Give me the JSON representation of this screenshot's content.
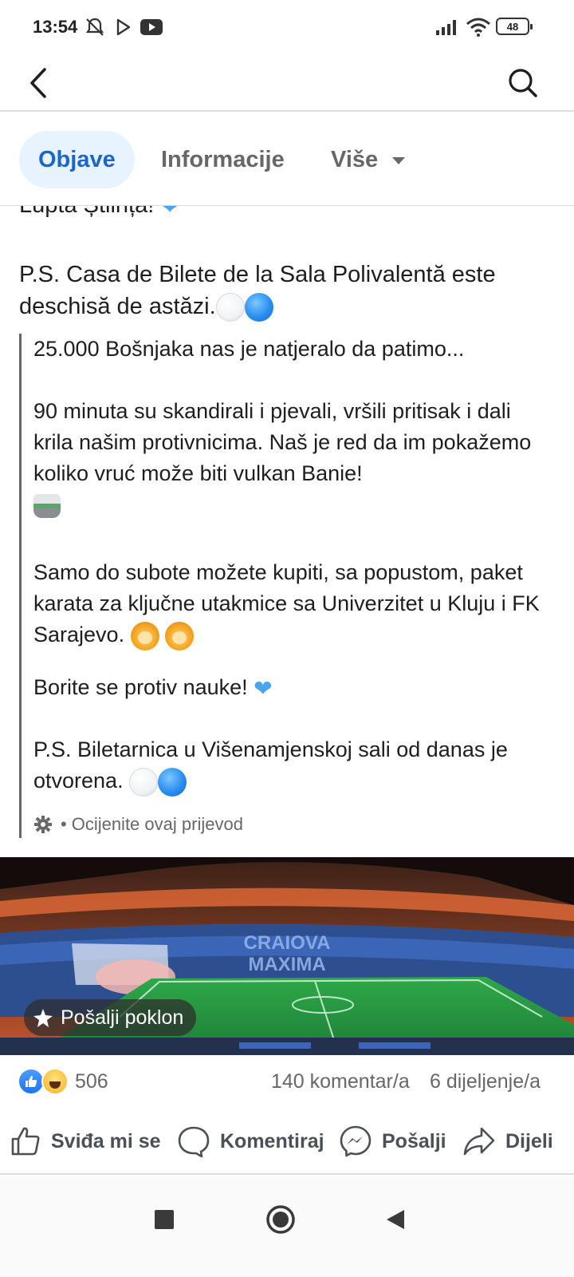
{
  "status_bar": {
    "time": "13:54",
    "battery": "48",
    "icons": [
      "mute-bell-icon",
      "play-store-icon",
      "youtube-icon",
      "signal-icon",
      "wifi-icon",
      "battery-icon"
    ]
  },
  "header": {
    "back_icon": "back-arrow-icon",
    "search_icon": "search-icon"
  },
  "tabs": [
    {
      "label": "Objave",
      "active": true
    },
    {
      "label": "Informacije",
      "active": false
    },
    {
      "label": "Više",
      "active": false
    }
  ],
  "post": {
    "clipped_line": "Lupta Știința!",
    "ps_original": "P.S. Casa de Bilete de la Sala Polivalentă este deschisă de astăzi.",
    "translation": {
      "p1": "25.000 Bošnjaka nas je natjeralo da patimo...",
      "p2": "90 minuta su skandirali i pjevali, vršili pritisak i dali krila našim protivnicima. Naš je red da im pokažemo koliko vruć može biti vulkan Banie!",
      "p3": "Samo do subote možete kupiti, sa popustom, paket karata za ključne utakmice sa Univerzitet u Kluju i FK Sarajevo.",
      "p4": "Borite se protiv nauke!",
      "p5": "P.S. Biletarnica u Višenamjenskoj sali od danas je otvorena.",
      "rate": "Ocijenite ovaj prijevod"
    },
    "photo": {
      "stand_text_1": "CRAIOVA",
      "stand_text_2": "MAXIMA",
      "gift_button": "Pošalji poklon"
    }
  },
  "reactions": {
    "count": "506",
    "comments": "140 komentar/a",
    "shares": "6 dijeljenje/a"
  },
  "actions": [
    {
      "label": "Sviđa mi se",
      "icon": "like-icon"
    },
    {
      "label": "Komentiraj",
      "icon": "comment-icon"
    },
    {
      "label": "Pošalji",
      "icon": "messenger-icon"
    },
    {
      "label": "Dijeli",
      "icon": "share-icon"
    }
  ],
  "navbar": {
    "icons": [
      "recents-square-icon",
      "home-circle-icon",
      "back-triangle-icon"
    ]
  },
  "colors": {
    "accent": "#1b66c9",
    "tab_active_bg": "#e7f3ff",
    "muted_text": "#65676b",
    "divider": "#dadde1"
  }
}
